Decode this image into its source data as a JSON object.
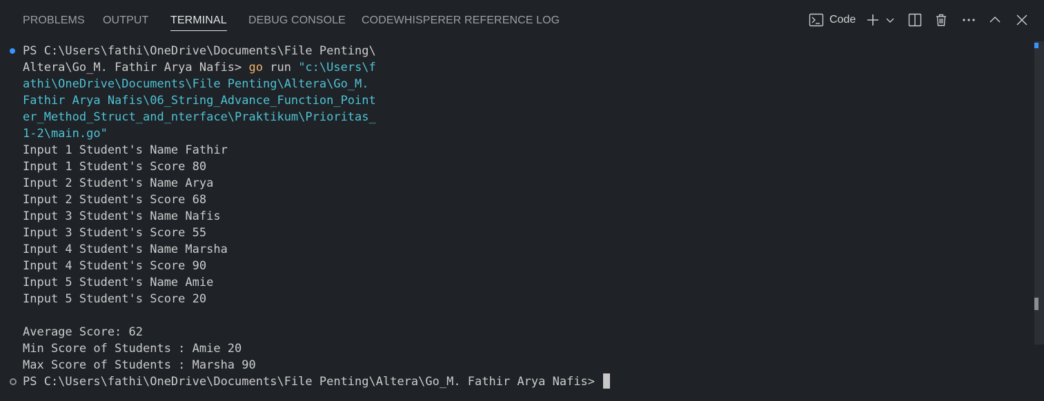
{
  "tabs": [
    {
      "label": "PROBLEMS"
    },
    {
      "label": "OUTPUT"
    },
    {
      "label": "TERMINAL",
      "active": true
    },
    {
      "label": "DEBUG CONSOLE"
    },
    {
      "label": "CODEWHISPERER REFERENCE LOG"
    }
  ],
  "actions": {
    "shell_label": "Code",
    "icons": [
      "terminal-icon",
      "plus-icon",
      "chevron-down-icon",
      "split-icon",
      "trash-icon",
      "more-icon",
      "chevron-up-icon",
      "close-icon"
    ]
  },
  "terminal": {
    "prompt_line1": "PS C:\\Users\\fathi\\OneDrive\\Documents\\File Penting\\",
    "prompt_line2_prefix": "Altera\\Go_M. Fathir Arya Nafis> ",
    "cmd_go": "go",
    "cmd_run": " run ",
    "cmd_str_1": "\"c:\\Users\\f",
    "cmd_str_2": "athi\\OneDrive\\Documents\\File Penting\\Altera\\Go_M.",
    "cmd_str_3": "Fathir Arya Nafis\\06_String_Advance_Function_Point",
    "cmd_str_4": "er_Method_Struct_and_nterface\\Praktikum\\Prioritas_",
    "cmd_str_5": "1-2\\main.go\"",
    "output": [
      "Input 1 Student's Name Fathir",
      "Input 1 Student's Score 80",
      "Input 2 Student's Name Arya",
      "Input 2 Student's Score 68",
      "Input 3 Student's Name Nafis",
      "Input 3 Student's Score 55",
      "Input 4 Student's Name Marsha",
      "Input 4 Student's Score 90",
      "Input 5 Student's Name Amie",
      "Input 5 Student's Score 20",
      "",
      "Average Score: 62",
      "Min Score of Students : Amie 20",
      "Max Score of Students : Marsha 90"
    ],
    "final_prompt": "PS C:\\Users\\fathi\\OneDrive\\Documents\\File Penting\\Altera\\Go_M. Fathir Arya Nafis> "
  },
  "colors": {
    "background": "#1f2227",
    "text": "#cccccc",
    "go_keyword": "#f0b46a",
    "string": "#4ec3d4",
    "success_dot": "#3794ff"
  }
}
